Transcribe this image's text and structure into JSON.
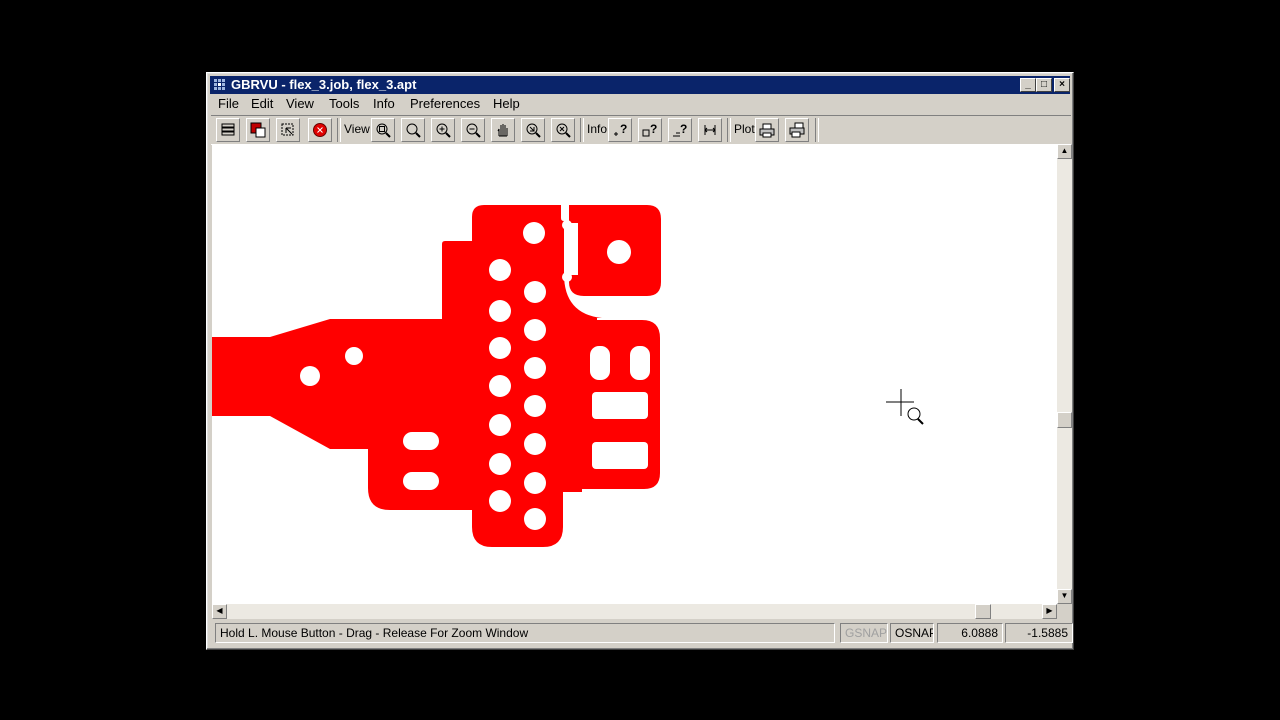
{
  "window": {
    "title": "GBRVU - flex_3.job, flex_3.apt",
    "controls": {
      "minimize": "_",
      "maximize": "□",
      "close": "×"
    }
  },
  "menu": [
    "File",
    "Edit",
    "View",
    "Tools",
    "Info",
    "Preferences",
    "Help"
  ],
  "toolbar": {
    "view_label": "View",
    "info_label": "Info",
    "plot_label": "Plot",
    "buttons": [
      "layers-icon",
      "color-layers-icon",
      "select-icon",
      "stop-icon",
      "zoom-window-icon",
      "zoom-fit-icon",
      "zoom-in-icon",
      "zoom-out-icon",
      "pan-icon",
      "zoom-previous-icon",
      "zoom-redraw-icon",
      "query-object-icon",
      "query-aperture-icon",
      "query-net-icon",
      "measure-icon",
      "print-icon",
      "plot-setup-icon"
    ]
  },
  "canvas": {
    "board_color": "#ff0000",
    "background": "#ffffff",
    "cursor": "zoom-cursor-icon"
  },
  "status": {
    "message": "Hold L. Mouse Button - Drag - Release For Zoom Window",
    "gsnap": "GSNAP",
    "osnap": "OSNAP",
    "x": "6.0888",
    "y": "-1.5885"
  }
}
